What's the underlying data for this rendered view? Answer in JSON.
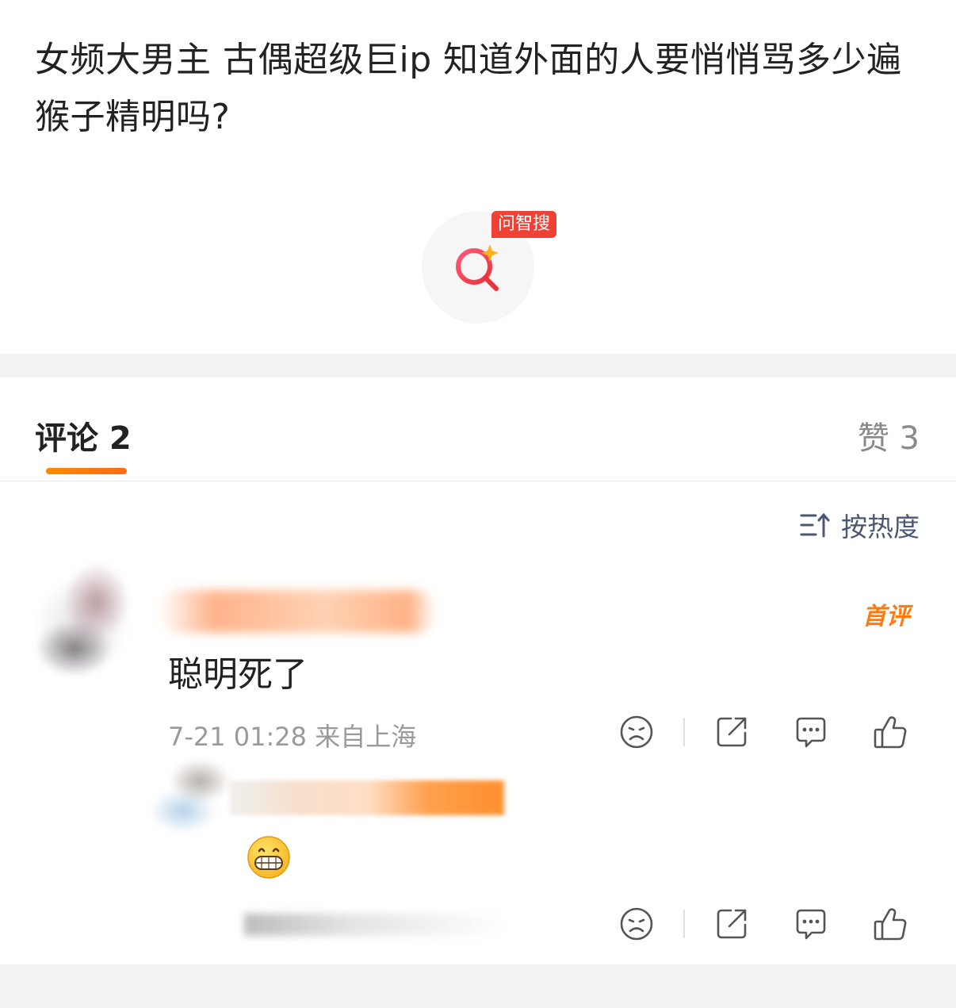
{
  "post": {
    "text": "女频大男主 古偶超级巨ip 知道外面的人要悄悄骂多少遍猴子精明吗?"
  },
  "zhisou": {
    "badge": "问智搜",
    "icon": "zhisou-search-sparkle-icon",
    "accent_color": "#f04135"
  },
  "tabs": {
    "comments_label": "评论 2",
    "likes_label": "赞 3",
    "underline_color": "#ff7a10"
  },
  "sort": {
    "label": "按热度",
    "icon": "sort-arrow-icon"
  },
  "comments": [
    {
      "first_badge": "首评",
      "text": "聪明死了",
      "meta": "7-21 01:28 来自上海",
      "actions": [
        "frown-icon",
        "share-icon",
        "comment-icon",
        "like-icon"
      ]
    },
    {
      "emoji": "grin-emoji",
      "actions": [
        "frown-icon",
        "share-icon",
        "comment-icon",
        "like-icon"
      ]
    }
  ]
}
